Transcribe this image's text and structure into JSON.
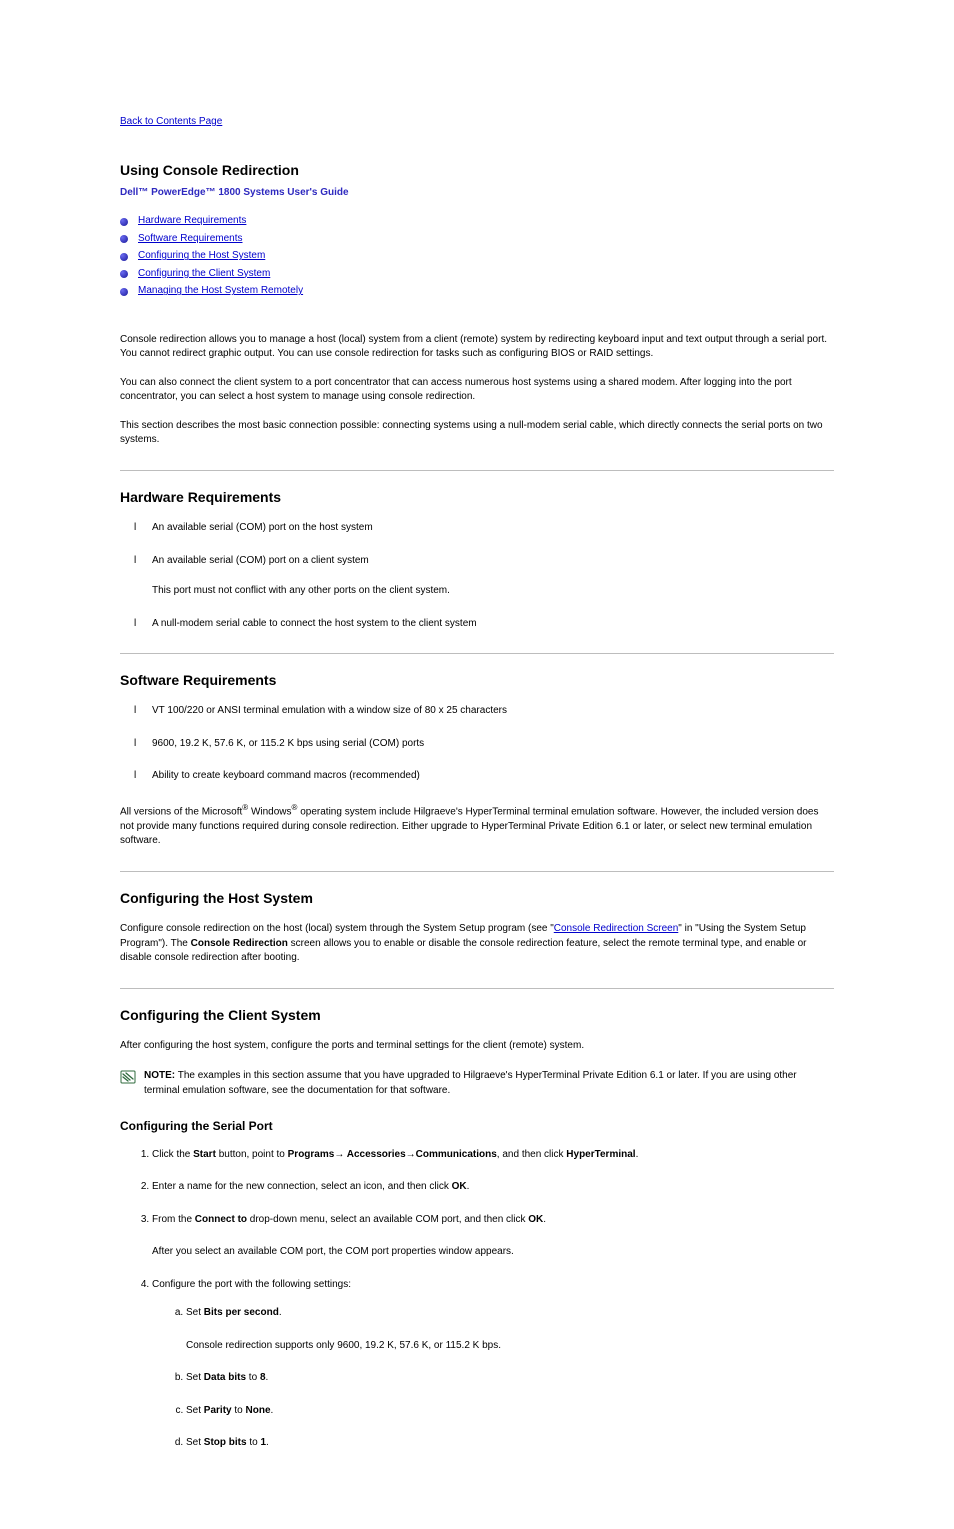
{
  "nav": {
    "back": "Back to Contents Page"
  },
  "header": {
    "appendix": "Using Console Redirection",
    "subtitle": "Dell™ PowerEdge™ 1800 Systems User's Guide"
  },
  "toc": [
    {
      "label": "Hardware Requirements"
    },
    {
      "label": "Software Requirements"
    },
    {
      "label": "Configuring the Host System"
    },
    {
      "label": "Configuring the Client System"
    },
    {
      "label": "Managing the Host System Remotely"
    }
  ],
  "intro": [
    "Console redirection allows you to manage a host (local) system from a client (remote) system by redirecting keyboard input and text output through a serial port. You cannot redirect graphic output. You can use console redirection for tasks such as configuring BIOS or RAID settings.",
    "You can also connect the client system to a port concentrator that can access numerous host systems using a shared modem. After logging into the port concentrator, you can select a host system to manage using console redirection.",
    "This section describes the most basic connection possible: connecting systems using a null-modem serial cable, which directly connects the serial ports on two systems."
  ],
  "hw": {
    "title": "Hardware Requirements",
    "items": [
      "An available serial (COM) port on the host system",
      "An available serial (COM) port on a client system",
      "This port must not conflict with any other ports on the client system.",
      "A null-modem serial cable to connect the host system to the client system"
    ]
  },
  "sw": {
    "title": "Software Requirements",
    "items": [
      "VT 100/220 or ANSI terminal emulation with a window size of 80 x 25 characters",
      "9600, 19.2 K, 57.6 K, or 115.2 K bps using serial (COM) ports",
      "Ability to create keyboard command macros (recommended)"
    ],
    "para1_pre": "All versions of the Microsoft",
    "para1_mid": " Windows",
    "para1_post": " operating system include Hilgraeve's HyperTerminal terminal emulation software. However, the included version does not provide many functions required during console redirection. Either upgrade to HyperTerminal Private Edition 6.1 or later, or select new terminal emulation software."
  },
  "host": {
    "title": "Configuring the Host System",
    "para_pre": "Configure console redirection on the host (local) system through the System Setup program (see \"",
    "link": "Console Redirection Screen",
    "para_mid": "\" in \"Using the System Setup Program\"). The ",
    "para_bold": "Console Redirection",
    "para_end": " screen allows you to enable or disable the console redirection feature, select the remote terminal type, and enable or disable console redirection after booting."
  },
  "client": {
    "title": "Configuring the Client System",
    "intro": "After configuring the host system, configure the ports and terminal settings for the client (remote) system.",
    "note_label": "NOTE:",
    "note_body": " The examples in this section assume that you have upgraded to Hilgraeve's HyperTerminal Private Edition 6.1 or later. If you are using other terminal emulation software, see the documentation for that software.",
    "port_title": "Configuring the Serial Port",
    "steps": {
      "s1_a": "Click the ",
      "s1_b": "Start",
      "s1_c": " button, point to ",
      "s1_d": "Programs",
      "s1_arrow1": "→",
      "s1_e": " Accessories",
      "s1_arrow2": "→",
      "s1_f": "Communications",
      "s1_g": ", and then click ",
      "s1_h": "HyperTerminal",
      "s1_i": ".",
      "s2": "Enter a name for the new connection, select an icon, and then click ",
      "s2_b": "OK",
      "s2_c": ".",
      "s3_a": "From the ",
      "s3_b": "Connect to",
      "s3_c": " drop-down menu, select an available COM port, and then click ",
      "s3_d": "OK",
      "s3_e": ".",
      "s3_para": "After you select an available COM port, the COM port properties window appears.",
      "s4": "Configure the port with the following settings:",
      "s4a_a": "Set ",
      "s4a_b": "Bits per second",
      "s4a_c": ".",
      "s4a_para": "Console redirection supports only 9600, 19.2 K, 57.6 K, or 115.2 K bps.",
      "s4b_a": "Set ",
      "s4b_b": "Data bits",
      "s4b_c": " to ",
      "s4b_d": "8",
      "s4b_e": ".",
      "s4c_a": "Set ",
      "s4c_b": "Parity",
      "s4c_c": " to ",
      "s4c_d": "None",
      "s4c_e": ".",
      "s4d_a": "Set ",
      "s4d_b": "Stop bits",
      "s4d_c": " to ",
      "s4d_d": "1",
      "s4d_e": "."
    }
  },
  "glyph": {
    "reg": "®"
  }
}
